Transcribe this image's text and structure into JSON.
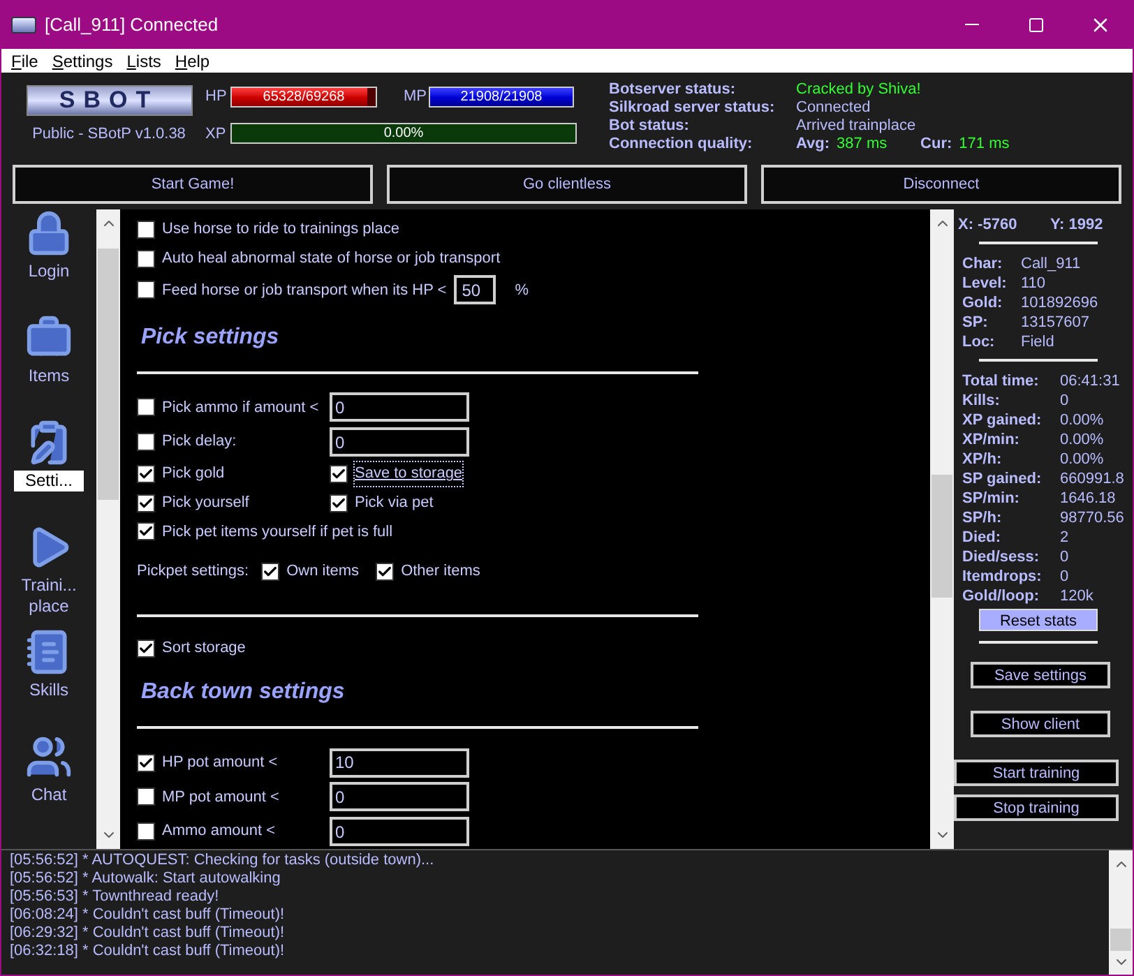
{
  "window": {
    "title": "[Call_911] Connected"
  },
  "menu": [
    "File",
    "Settings",
    "Lists",
    "Help"
  ],
  "header": {
    "logo": "SBOT",
    "version": "Public - SBotP v1.0.38",
    "bars": [
      {
        "kind": "hp",
        "label": "HP",
        "reading": "65328/69268",
        "level": 0.94
      },
      {
        "kind": "mp",
        "label": "MP",
        "reading": "21908/21908",
        "level": 1
      },
      {
        "kind": "xp",
        "label": "XP",
        "reading": "0.00%",
        "level": 0
      }
    ],
    "status": [
      {
        "label": "Botserver status:",
        "value": "Cracked by Shiva!",
        "highlight": true
      },
      {
        "label": "Silkroad server status:",
        "value": "Connected",
        "highlight": false
      },
      {
        "label": "Bot status:",
        "value": "Arrived trainplace",
        "highlight": false
      }
    ],
    "quality": {
      "label": "Connection quality:",
      "avg_label": "Avg:",
      "avg": "387 ms",
      "cur_label": "Cur:",
      "cur": "171 ms"
    }
  },
  "actions": [
    "Start Game!",
    "Go clientless",
    "Disconnect"
  ],
  "sidebar": [
    {
      "kind": "lock",
      "label": "Login",
      "selected": false
    },
    {
      "kind": "briefcase",
      "label": "Items",
      "selected": false
    },
    {
      "kind": "clipboard",
      "label": "Setti...",
      "selected": true
    },
    {
      "kind": "play",
      "label": "Traini... place",
      "selected": false
    },
    {
      "kind": "notebook",
      "label": "Skills",
      "selected": false
    },
    {
      "kind": "users",
      "label": "Chat",
      "selected": false
    }
  ],
  "settings": [
    {
      "kind": "check",
      "label": "Use horse to ride to trainings place",
      "checked": false
    },
    {
      "kind": "check",
      "label": "Auto heal abnormal state of horse or job transport",
      "checked": false
    },
    {
      "kind": "check_input",
      "label": "Feed horse or job transport when its HP <",
      "checked": false,
      "value": "50",
      "unit": "%"
    },
    {
      "kind": "heading",
      "text": "Pick settings"
    },
    {
      "kind": "divider"
    },
    {
      "kind": "check_input",
      "label": "Pick ammo if amount <",
      "checked": false,
      "value": "0"
    },
    {
      "kind": "check_input",
      "label": "Pick delay:",
      "checked": false,
      "value": "0"
    },
    {
      "kind": "pair",
      "items": [
        {
          "label": "Pick gold",
          "checked": true,
          "focused": false
        },
        {
          "label": "Save to storage",
          "checked": true,
          "focused": true
        }
      ]
    },
    {
      "kind": "pair",
      "items": [
        {
          "label": "Pick yourself",
          "checked": true,
          "focused": false
        },
        {
          "label": "Pick via pet",
          "checked": true,
          "focused": false
        }
      ]
    },
    {
      "kind": "check",
      "label": "Pick pet items yourself if pet is full",
      "checked": true
    },
    {
      "kind": "group",
      "label": "Pickpet settings:",
      "items": [
        {
          "label": "Own items",
          "checked": true
        },
        {
          "label": "Other items",
          "checked": true
        }
      ]
    },
    {
      "kind": "divider"
    },
    {
      "kind": "check",
      "label": "Sort storage",
      "checked": true
    },
    {
      "kind": "heading",
      "text": "Back town settings"
    },
    {
      "kind": "divider"
    },
    {
      "kind": "check_input",
      "label": "HP pot amount <",
      "checked": true,
      "value": "10"
    },
    {
      "kind": "check_input",
      "label": "MP pot amount <",
      "checked": false,
      "value": "0"
    },
    {
      "kind": "check_input",
      "label": "Ammo amount <",
      "checked": false,
      "value": "0"
    }
  ],
  "info": {
    "x": "X: -5760",
    "y": "Y: 1992",
    "char": [
      {
        "label": "Char:",
        "value": "Call_911"
      },
      {
        "label": "Level:",
        "value": "110"
      },
      {
        "label": "Gold:",
        "value": "101892696"
      },
      {
        "label": "SP:",
        "value": "13157607"
      },
      {
        "label": "Loc:",
        "value": "Field"
      }
    ],
    "stats": [
      {
        "label": "Total time:",
        "value": "06:41:31"
      },
      {
        "label": "Kills:",
        "value": "0"
      },
      {
        "label": "XP gained:",
        "value": "0.00%"
      },
      {
        "label": "XP/min:",
        "value": "0.00%"
      },
      {
        "label": "XP/h:",
        "value": "0.00%"
      },
      {
        "label": "SP gained:",
        "value": "660991.8"
      },
      {
        "label": "SP/min:",
        "value": "1646.18"
      },
      {
        "label": "SP/h:",
        "value": "98770.56"
      },
      {
        "label": "Died:",
        "value": "2"
      },
      {
        "label": "Died/sess:",
        "value": "0"
      },
      {
        "label": "Itemdrops:",
        "value": "0"
      },
      {
        "label": "Gold/loop:",
        "value": "120k"
      }
    ],
    "reset": "Reset stats",
    "buttons": [
      "Save settings",
      "Show client"
    ],
    "training": [
      "Start training",
      "Stop training"
    ]
  },
  "log": [
    "[05:56:52] * AUTOQUEST: Checking for tasks (outside town)...",
    "[05:56:52] * Autowalk: Start autowalking",
    "[05:56:53] * Townthread ready!",
    "[06:08:24] * Couldn't cast buff (Timeout)!",
    "[06:29:32] * Couldn't cast buff (Timeout)!",
    "[06:32:18] * Couldn't cast buff (Timeout)!"
  ]
}
